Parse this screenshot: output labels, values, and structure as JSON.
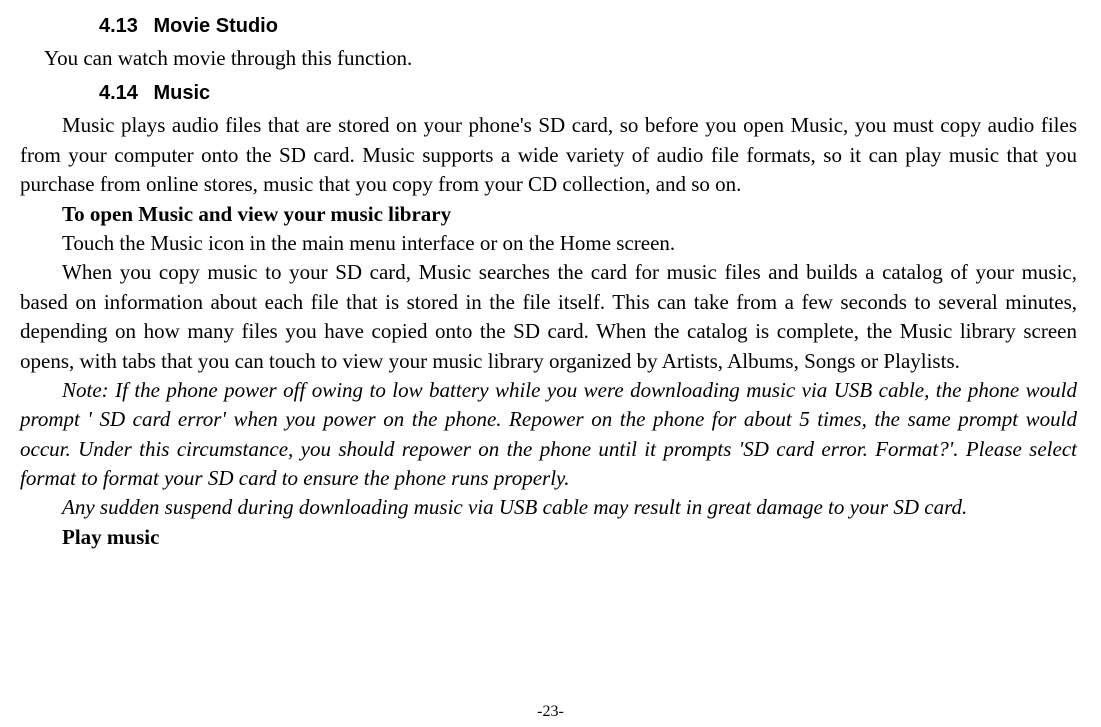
{
  "sections": {
    "s413": {
      "number": "4.13",
      "title": "Movie Studio",
      "p1": "You can watch movie through this function."
    },
    "s414": {
      "number": "4.14",
      "title": "Music",
      "p1": "Music plays audio files that are stored on your phone's SD card, so before you open Music, you must copy audio files from your computer onto the SD card. Music supports a wide variety of audio file formats, so it can play music that you purchase from online stores, music that you copy from your CD collection, and so on.",
      "sub1": "To open Music and view your music library",
      "p2": "Touch the Music icon in the main menu interface or on the Home screen.",
      "p3": "When you copy music to your SD card, Music searches the card for music files and builds a catalog of your music, based on information about each file that is stored in the file itself. This can take from a few seconds to several minutes, depending on how many files you have copied onto the SD card. When the catalog is complete, the Music library screen opens, with tabs that you can touch to view your music library organized by Artists, Albums, Songs or Playlists.",
      "note1": "Note: If the phone power off owing to low battery while you were downloading music via USB cable, the phone would prompt ' SD card error' when you power on the phone. Repower on the phone for about 5 times, the same prompt would occur. Under this circumstance, you should repower on the phone until it prompts 'SD card error. Format?'. Please select format to format your SD card to ensure the phone runs properly.",
      "note2": "Any sudden suspend during downloading music via USB cable may result in great damage to your SD card.",
      "sub2": "Play music"
    }
  },
  "pageNumber": "-23-"
}
